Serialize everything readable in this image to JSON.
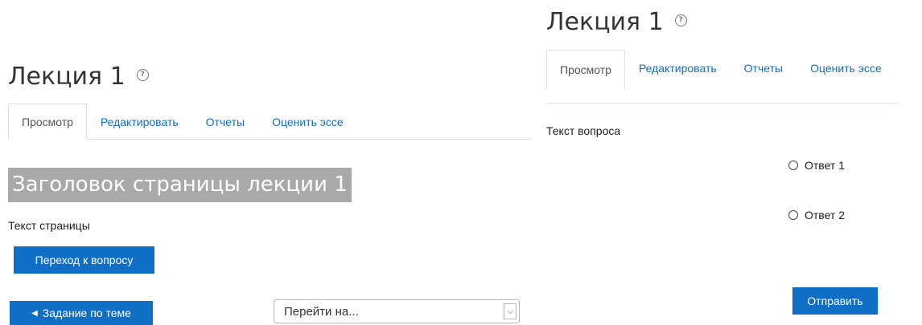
{
  "left": {
    "page_title": "Лекция 1",
    "tabs": [
      {
        "label": "Просмотр",
        "active": true
      },
      {
        "label": "Редактировать",
        "active": false
      },
      {
        "label": "Отчеты",
        "active": false
      },
      {
        "label": "Оценить эссе",
        "active": false
      }
    ],
    "lesson_heading": "Заголовок страницы лекции 1",
    "page_text": "Текст страницы",
    "next_button": "Переход к вопросу",
    "prev_button": "Задание по теме",
    "jump_select": {
      "selected": "Перейти на..."
    }
  },
  "right": {
    "page_title": "Лекция 1",
    "tabs": [
      {
        "label": "Просмотр",
        "active": true
      },
      {
        "label": "Редактировать",
        "active": false
      },
      {
        "label": "Отчеты",
        "active": false
      },
      {
        "label": "Оценить эссе",
        "active": false
      }
    ],
    "question_text": "Текст вопроса",
    "answers": [
      "Ответ 1",
      "Ответ 2"
    ],
    "submit_button": "Отправить"
  },
  "icons": {
    "help": "question-circle-icon",
    "prev_arrow": "triangle-left-icon",
    "dropdown": "chevron-down-icon"
  },
  "colors": {
    "primary": "#0f6fc5",
    "heading_bg": "#a9a9a9",
    "tab_border": "#dee2e6"
  }
}
